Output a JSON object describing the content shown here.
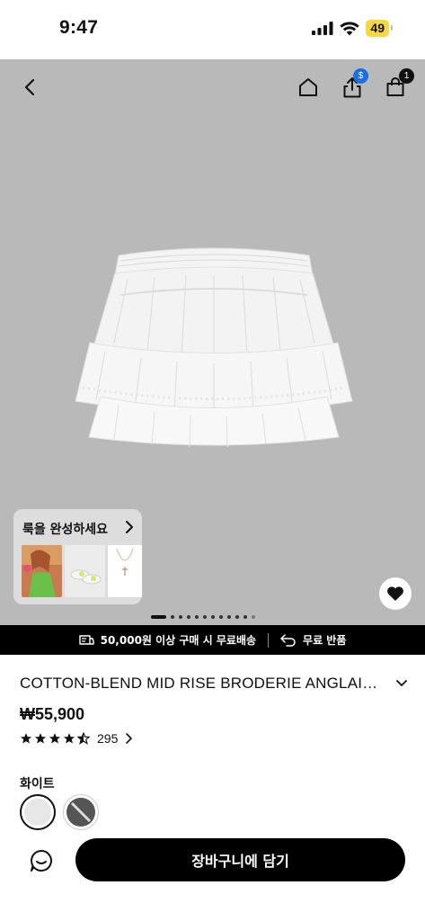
{
  "status_bar": {
    "time": "9:47",
    "battery": "49"
  },
  "hero": {
    "icons": [
      "back-icon",
      "home-icon",
      "share-icon",
      "cart-icon",
      "heart-icon"
    ],
    "share_badge": "$",
    "cart_badge": "1",
    "look_card": {
      "title": "룩을 완성하세요"
    },
    "gallery": {
      "total_images": 12,
      "current_index": 1
    }
  },
  "promo": {
    "free_shipping": "50,000원 이상 구매 시 무료배송",
    "free_return": "무료 반품"
  },
  "product": {
    "title": "COTTON-BLEND MID RISE BRODERIE ANGLAI…",
    "price": "₩55,900",
    "rating": 4.5,
    "review_count": "295",
    "color_label": "화이트"
  },
  "actions": {
    "add_to_cart": "장바구니에 담기"
  },
  "colors": {
    "accent": "#000000",
    "badge_blue": "#1d6fe0",
    "hero_bg": "#b9b9b9",
    "battery": "#f7d93e"
  }
}
